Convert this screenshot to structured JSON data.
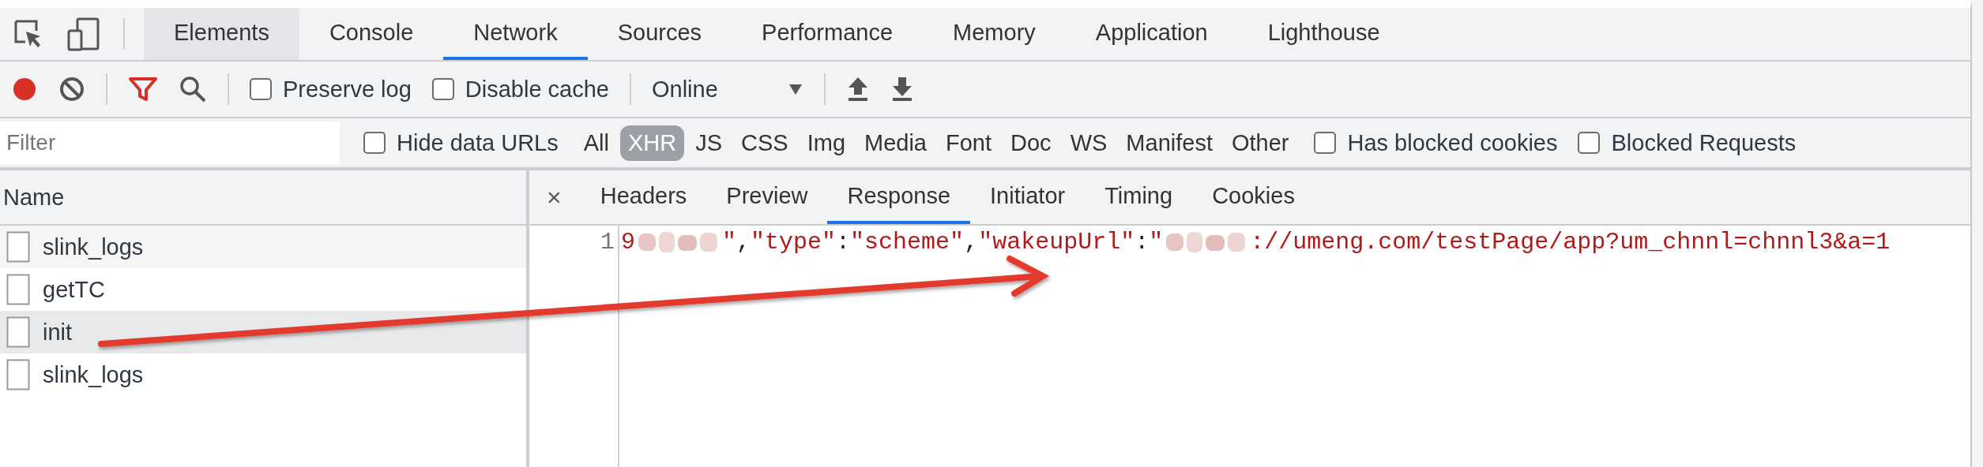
{
  "main_tabs": [
    {
      "label": "Elements",
      "selected": false,
      "hovered": true
    },
    {
      "label": "Console",
      "selected": false,
      "hovered": false
    },
    {
      "label": "Network",
      "selected": true,
      "hovered": false
    },
    {
      "label": "Sources",
      "selected": false,
      "hovered": false
    },
    {
      "label": "Performance",
      "selected": false,
      "hovered": false
    },
    {
      "label": "Memory",
      "selected": false,
      "hovered": false
    },
    {
      "label": "Application",
      "selected": false,
      "hovered": false
    },
    {
      "label": "Lighthouse",
      "selected": false,
      "hovered": false
    }
  ],
  "toolbar": {
    "recording": true,
    "filter_active": true,
    "preserve_log": {
      "label": "Preserve log",
      "checked": false
    },
    "disable_cache": {
      "label": "Disable cache",
      "checked": false
    },
    "throttling": "Online"
  },
  "filter_bar": {
    "placeholder": "Filter",
    "hide_data_urls": {
      "label": "Hide data URLs",
      "checked": false
    },
    "types": [
      {
        "label": "All",
        "selected": false
      },
      {
        "label": "XHR",
        "selected": true
      },
      {
        "label": "JS",
        "selected": false
      },
      {
        "label": "CSS",
        "selected": false
      },
      {
        "label": "Img",
        "selected": false
      },
      {
        "label": "Media",
        "selected": false
      },
      {
        "label": "Font",
        "selected": false
      },
      {
        "label": "Doc",
        "selected": false
      },
      {
        "label": "WS",
        "selected": false
      },
      {
        "label": "Manifest",
        "selected": false
      },
      {
        "label": "Other",
        "selected": false
      }
    ],
    "has_blocked_cookies": {
      "label": "Has blocked cookies",
      "checked": false
    },
    "blocked_requests": {
      "label": "Blocked Requests",
      "checked": false
    }
  },
  "requests": {
    "column": "Name",
    "rows": [
      {
        "name": "slink_logs",
        "selected": false
      },
      {
        "name": "getTC",
        "selected": false
      },
      {
        "name": "init",
        "selected": true
      },
      {
        "name": "slink_logs",
        "selected": false
      }
    ]
  },
  "detail": {
    "close_symbol": "×",
    "tabs": [
      {
        "label": "Headers",
        "selected": false
      },
      {
        "label": "Preview",
        "selected": false
      },
      {
        "label": "Response",
        "selected": true
      },
      {
        "label": "Initiator",
        "selected": false
      },
      {
        "label": "Timing",
        "selected": false
      },
      {
        "label": "Cookies",
        "selected": false
      }
    ],
    "response_lines": [
      {
        "number": "1",
        "segments": [
          {
            "kind": "string",
            "text": "9"
          },
          {
            "kind": "redacted"
          },
          {
            "kind": "string",
            "text": "\""
          },
          {
            "kind": "punct",
            "text": ","
          },
          {
            "kind": "string",
            "text": "\"type\""
          },
          {
            "kind": "punct",
            "text": ":"
          },
          {
            "kind": "string",
            "text": "\"scheme\""
          },
          {
            "kind": "punct",
            "text": ","
          },
          {
            "kind": "string",
            "text": "\"wakeupUrl\""
          },
          {
            "kind": "punct",
            "text": ":"
          },
          {
            "kind": "string",
            "text": "\""
          },
          {
            "kind": "redacted"
          },
          {
            "kind": "string",
            "text": "://umeng.com/testPage/app?um_chnnl=chnnl3&a=1"
          }
        ]
      }
    ]
  },
  "annotation": {
    "kind": "arrow"
  }
}
